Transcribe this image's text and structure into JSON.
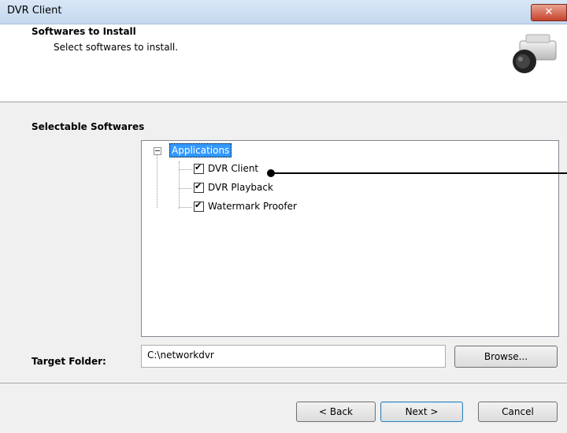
{
  "window": {
    "title": "DVR Client",
    "close_glyph": "✕"
  },
  "header": {
    "title": "Softwares to Install",
    "subtitle": "Select softwares to install.",
    "icon": "camera-icon"
  },
  "selectable": {
    "label": "Selectable Softwares",
    "root": {
      "label": "Applications",
      "expanded": true
    },
    "items": [
      {
        "label": "DVR Client",
        "checked": true
      },
      {
        "label": "DVR Playback",
        "checked": true
      },
      {
        "label": "Watermark Proofer",
        "checked": true
      }
    ]
  },
  "target_folder": {
    "label": "Target Folder:",
    "value": "C:\\networkdvr",
    "browse_label": "Browse..."
  },
  "buttons": {
    "back": "< Back",
    "next": "Next >",
    "cancel": "Cancel"
  },
  "colors": {
    "selection": "#3399ff",
    "close": "#c7432c"
  }
}
